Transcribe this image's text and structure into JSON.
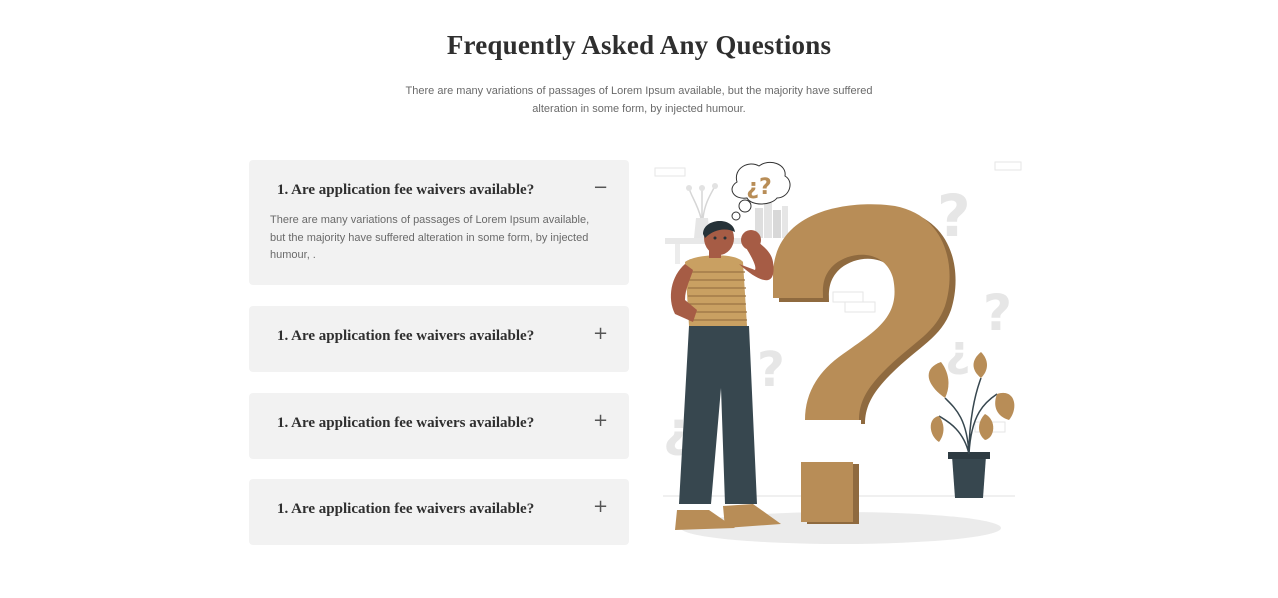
{
  "header": {
    "title": "Frequently Asked Any Questions",
    "subtitle": "There are many variations of passages of Lorem Ipsum available, but the majority have suffered alteration in some form, by injected humour."
  },
  "faq": {
    "items": [
      {
        "question": "1. Are application fee waivers available?",
        "answer": "There are many variations of passages of Lorem Ipsum available, but the majority have suffered alteration in some form, by injected humour, .",
        "expanded": true,
        "toggle_icon": "minus-icon",
        "toggle_glyph": "−"
      },
      {
        "question": "1. Are application fee waivers available?",
        "expanded": false,
        "toggle_icon": "plus-icon",
        "toggle_glyph": "+"
      },
      {
        "question": "1. Are application fee waivers available?",
        "expanded": false,
        "toggle_icon": "plus-icon",
        "toggle_glyph": "+"
      },
      {
        "question": "1. Are application fee waivers available?",
        "expanded": false,
        "toggle_icon": "plus-icon",
        "toggle_glyph": "+"
      }
    ]
  },
  "illustration": {
    "thought_bubble_text": "¿?",
    "colors": {
      "accent": "#b88d57",
      "dark": "#37474f",
      "skin": "#a65c45",
      "light_gray": "#ebebeb"
    }
  }
}
